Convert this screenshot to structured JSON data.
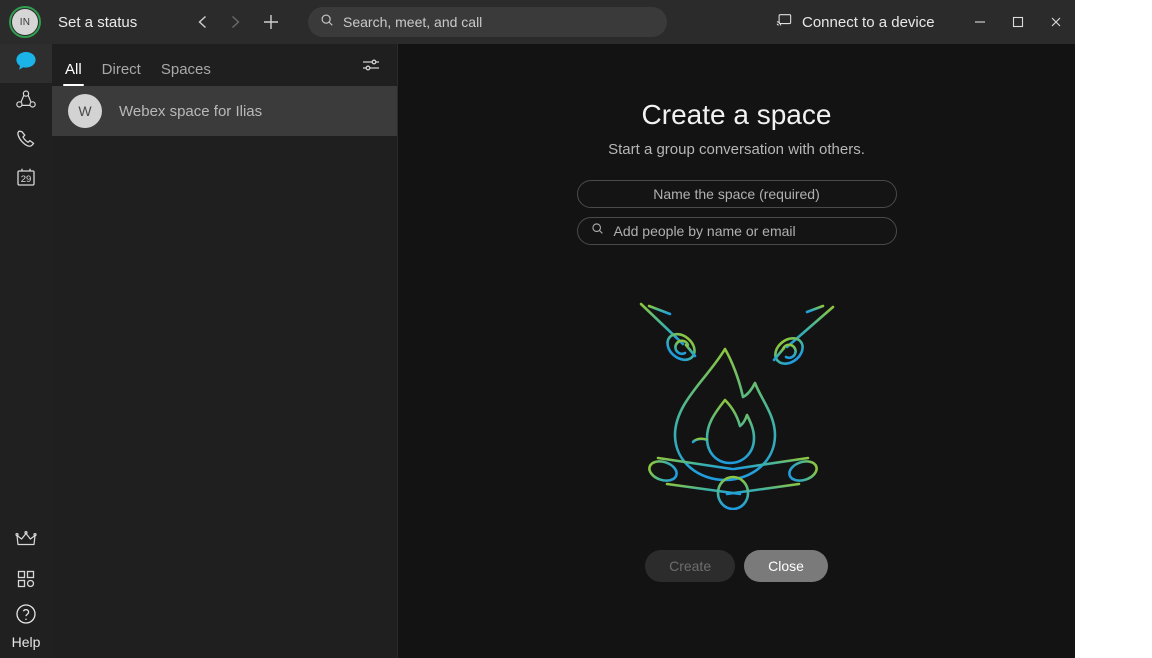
{
  "title_bar": {
    "avatar_initials": "IN",
    "avatar_ring_color": "#2f9e4f",
    "status_label": "Set a status",
    "nav_back_icon": "chevron-left-icon",
    "nav_forward_icon": "chevron-right-icon",
    "add_icon": "plus-icon",
    "search": {
      "icon": "search-icon",
      "placeholder": "Search, meet, and call",
      "value": ""
    },
    "connect_device": {
      "icon": "cast-device-icon",
      "label": "Connect to a device"
    },
    "window_controls": {
      "minimize": "minimize-icon",
      "maximize": "maximize-icon",
      "close": "close-icon"
    }
  },
  "left_rail": {
    "items": [
      {
        "name": "messaging",
        "icon": "chat-bubble-icon",
        "active": true
      },
      {
        "name": "teams",
        "icon": "teams-icon",
        "active": false
      },
      {
        "name": "calling",
        "icon": "phone-icon",
        "active": false
      },
      {
        "name": "meetings",
        "icon": "calendar-icon",
        "day_number": "29",
        "active": false
      }
    ],
    "bottom_items": [
      {
        "name": "upgrade",
        "icon": "crown-icon"
      },
      {
        "name": "apps",
        "icon": "apps-grid-icon"
      },
      {
        "name": "help",
        "icon": "help-circle-icon",
        "label": "Help"
      }
    ]
  },
  "space_panel": {
    "tabs": [
      {
        "label": "All",
        "active": true
      },
      {
        "label": "Direct",
        "active": false
      },
      {
        "label": "Spaces",
        "active": false
      }
    ],
    "filter_icon": "filter-sliders-icon",
    "spaces": [
      {
        "initial": "W",
        "name": "Webex space for Ilias",
        "selected": true
      }
    ]
  },
  "main": {
    "title": "Create a space",
    "subtitle": "Start a group conversation with others.",
    "name_field": {
      "placeholder": "Name the space (required)",
      "value": ""
    },
    "people_field": {
      "icon": "search-icon",
      "placeholder": "Add people by name or email",
      "value": ""
    },
    "illustration": {
      "name": "campfire-marshmallows-illustration",
      "gradient_start": "#8dc63f",
      "gradient_end": "#1f9ce0"
    },
    "buttons": {
      "create": {
        "label": "Create",
        "disabled": true
      },
      "close": {
        "label": "Close",
        "disabled": false
      }
    }
  }
}
